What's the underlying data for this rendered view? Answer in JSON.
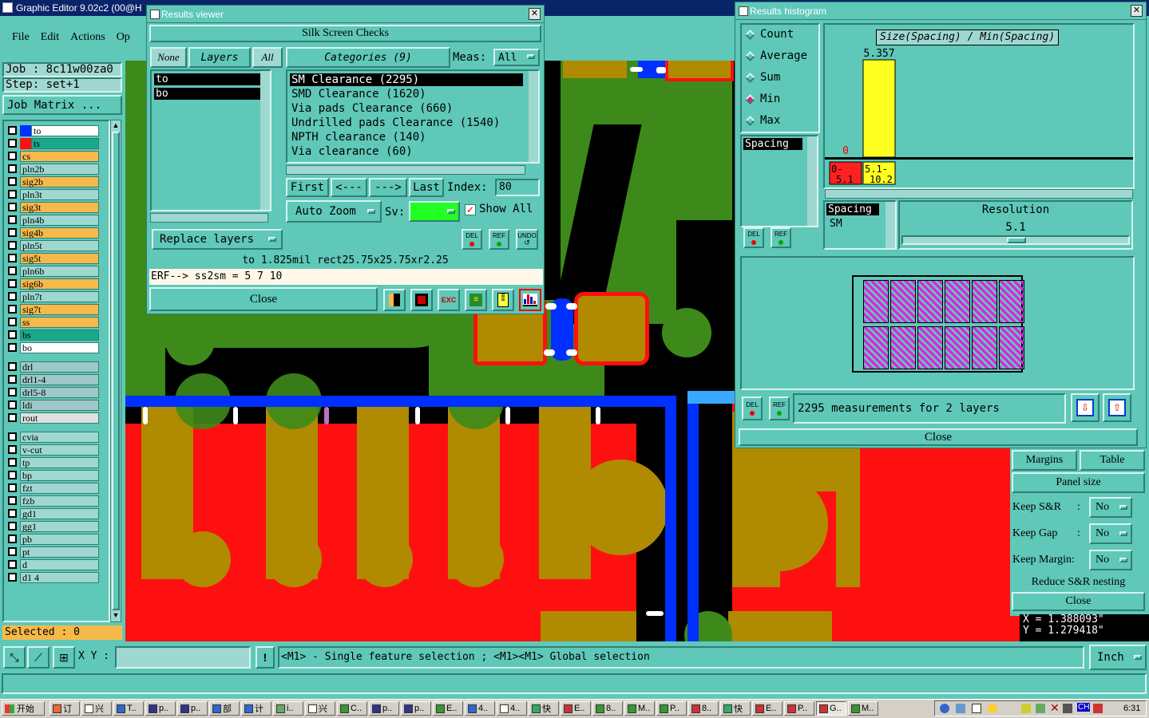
{
  "app": {
    "title": "Graphic Editor 9.02c2 (00@H",
    "menu": [
      "File",
      "Edit",
      "Actions",
      "Op"
    ],
    "job_label": "Job : 8c11w00za0",
    "step_label": "Step: set+1",
    "job_matrix": "Job Matrix ...",
    "selected": "Selected : 0",
    "xy_label": "X Y :",
    "xy_value": "",
    "status_msg": "<M1> - Single feature selection ; <M1><M1> Global selection",
    "units": "Inch",
    "coord_x": "X = 1.388093\"",
    "coord_y": "Y = 1.279418\""
  },
  "layers": [
    {
      "name": "to",
      "color": "#ffffff",
      "swatch": "#0030ff"
    },
    {
      "name": "ts",
      "color": "#1aa88a",
      "swatch": "#ff1010"
    },
    {
      "name": "cs",
      "color": "#f6b94a",
      "swatch": null
    },
    {
      "name": "pln2b",
      "color": "#9fd8d0",
      "swatch": null
    },
    {
      "name": "sig2b",
      "color": "#f6b94a",
      "swatch": null
    },
    {
      "name": "pln3t",
      "color": "#9fd8d0",
      "swatch": null
    },
    {
      "name": "sig3t",
      "color": "#f6b94a",
      "swatch": null
    },
    {
      "name": "pln4b",
      "color": "#9fd8d0",
      "swatch": null
    },
    {
      "name": "sig4b",
      "color": "#f6b94a",
      "swatch": null
    },
    {
      "name": "pln5t",
      "color": "#9fd8d0",
      "swatch": null
    },
    {
      "name": "sig5t",
      "color": "#f6b94a",
      "swatch": null
    },
    {
      "name": "pln6b",
      "color": "#9fd8d0",
      "swatch": null
    },
    {
      "name": "sig6b",
      "color": "#f6b94a",
      "swatch": null
    },
    {
      "name": "pln7t",
      "color": "#9fd8d0",
      "swatch": null
    },
    {
      "name": "sig7t",
      "color": "#f6b94a",
      "swatch": null
    },
    {
      "name": "ss",
      "color": "#f6b94a",
      "swatch": null
    },
    {
      "name": "bs",
      "color": "#1aa88a",
      "swatch": null
    },
    {
      "name": "bo",
      "color": "#ffffff",
      "swatch": null
    },
    {
      "name": "drl",
      "color": "#9fc8c8",
      "swatch": null
    },
    {
      "name": "drl1-4",
      "color": "#9fc8c8",
      "swatch": null
    },
    {
      "name": "drl5-8",
      "color": "#9fc8c8",
      "swatch": null
    },
    {
      "name": "ldi",
      "color": "#9fc8c8",
      "swatch": null
    },
    {
      "name": "rout",
      "color": "#e0e0e0",
      "swatch": null
    },
    {
      "name": "cvia",
      "color": "#9fd8d0",
      "swatch": null
    },
    {
      "name": "v-cut",
      "color": "#9fd8d0",
      "swatch": null
    },
    {
      "name": "tp",
      "color": "#9fd8d0",
      "swatch": null
    },
    {
      "name": "bp",
      "color": "#9fd8d0",
      "swatch": null
    },
    {
      "name": "fzt",
      "color": "#9fd8d0",
      "swatch": null
    },
    {
      "name": "fzb",
      "color": "#9fd8d0",
      "swatch": null
    },
    {
      "name": "gd1",
      "color": "#9fd8d0",
      "swatch": null
    },
    {
      "name": "gg1",
      "color": "#9fd8d0",
      "swatch": null
    },
    {
      "name": "pb",
      "color": "#9fd8d0",
      "swatch": null
    },
    {
      "name": "pt",
      "color": "#9fd8d0",
      "swatch": null
    },
    {
      "name": "d",
      "color": "#9fd8d0",
      "swatch": null
    },
    {
      "name": "d1 4",
      "color": "#9fd8d0",
      "swatch": null
    }
  ],
  "results_viewer": {
    "title": "Results viewer",
    "header": "Silk Screen Checks",
    "none_btn": "None",
    "layers_btn": "Layers",
    "all_btn": "All",
    "categories_btn": "Categories (9)",
    "meas_label": "Meas:",
    "meas_value": "All",
    "layers": [
      "to",
      "bo"
    ],
    "categories": [
      "SM Clearance (2295)",
      "SMD Clearance (1620)",
      "Via pads Clearance (660)",
      "Undrilled pads Clearance (1540)",
      "NPTH clearance (140)",
      "Via clearance (60)"
    ],
    "first": "First",
    "prev": "<---",
    "next": "--->",
    "last": "Last",
    "index_label": "Index:",
    "index_value": "80",
    "auto_zoom": "Auto Zoom",
    "sv_label": "Sv:",
    "show_all": "Show All",
    "replace_layers": "Replace layers",
    "del": "DEL",
    "ref": "REF",
    "undo": "UNDO",
    "info_line": "to 1.825mil  rect25.75x25.75xr2.25",
    "erf_line": "ERF--> ss2sm = 5 7 10",
    "close": "Close"
  },
  "histogram": {
    "title": "Results histogram",
    "modes": [
      "Count",
      "Average",
      "Sum",
      "Min",
      "Max"
    ],
    "selected_mode": "Min",
    "chart_title": "Size(Spacing) / Min(Spacing)",
    "list1": [
      "Spacing"
    ],
    "list2": [
      "Spacing",
      "SM"
    ],
    "resolution_label": "Resolution",
    "resolution_value": "5.1",
    "summary": "2295 measurements for 2 layers",
    "close": "Close",
    "del": "DEL",
    "ref": "REF"
  },
  "chart_data": {
    "type": "bar",
    "title": "Size(Spacing) / Min(Spacing)",
    "categories": [
      "0-5.1",
      "5.1-10.2"
    ],
    "values": [
      0,
      5.357
    ],
    "bar_colors": [
      "#ff2020",
      "#ffff20"
    ],
    "data_labels": [
      "0",
      "5.357"
    ]
  },
  "right_panel": {
    "margins": "Margins",
    "table": "Table",
    "panel_size": "Panel size",
    "keep_sr_label": "Keep S&R",
    "keep_gap_label": "Keep Gap",
    "keep_margin_label": "Keep Margin:",
    "colon": ":",
    "no": "No",
    "reduce": "Reduce S&R nesting",
    "close": "Close"
  },
  "taskbar": {
    "start": "开始",
    "items": [
      "订",
      "兴",
      "T..",
      "p..",
      "p..",
      "部",
      "计",
      "i..",
      "兴",
      "C..",
      "p..",
      "p..",
      "E..",
      "4..",
      "4..",
      "快",
      "E..",
      "8..",
      "M..",
      "P..",
      "8..",
      "快",
      "E..",
      "P..",
      "G..",
      "M.."
    ],
    "clock": "6:31",
    "ch": "CH"
  }
}
